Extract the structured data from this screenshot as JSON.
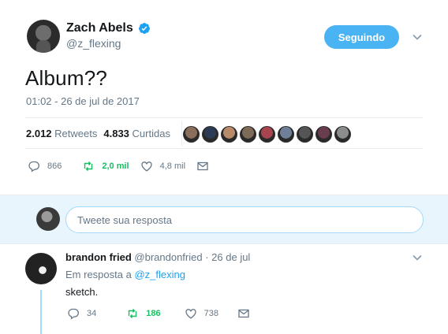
{
  "tweet": {
    "author_name": "Zach Abels",
    "author_handle": "@z_flexing",
    "follow_label": "Seguindo",
    "text": "Album??",
    "timestamp": "01:02 - 26 de jul de 2017",
    "stats": {
      "retweets_count": "2.012",
      "retweets_label": "Retweets",
      "likes_count": "4.833",
      "likes_label": "Curtidas"
    },
    "liker_colors": [
      "#8a6d5a",
      "#2b3a55",
      "#b88a6a",
      "#7d6a57",
      "#a8444f",
      "#6f7f98",
      "#555555",
      "#6a3d4e",
      "#8c8c8c"
    ],
    "actions": {
      "replies": "866",
      "retweets": "2,0 mil",
      "likes": "4,8 mil"
    }
  },
  "reply_box": {
    "placeholder": "Tweete sua resposta"
  },
  "reply": {
    "author_name": "brandon fried",
    "author_handle": "@brandonfried",
    "date": "· 26 de jul",
    "in_reply_prefix": "Em resposta a",
    "in_reply_handle": "@z_flexing",
    "text": "sketch.",
    "actions": {
      "replies": "34",
      "retweets": "186",
      "likes": "738"
    }
  },
  "colors": {
    "accent": "#1da1f2",
    "follow_button": "#4ab3f4",
    "retweet_green": "#17bf63",
    "muted": "#657786"
  }
}
